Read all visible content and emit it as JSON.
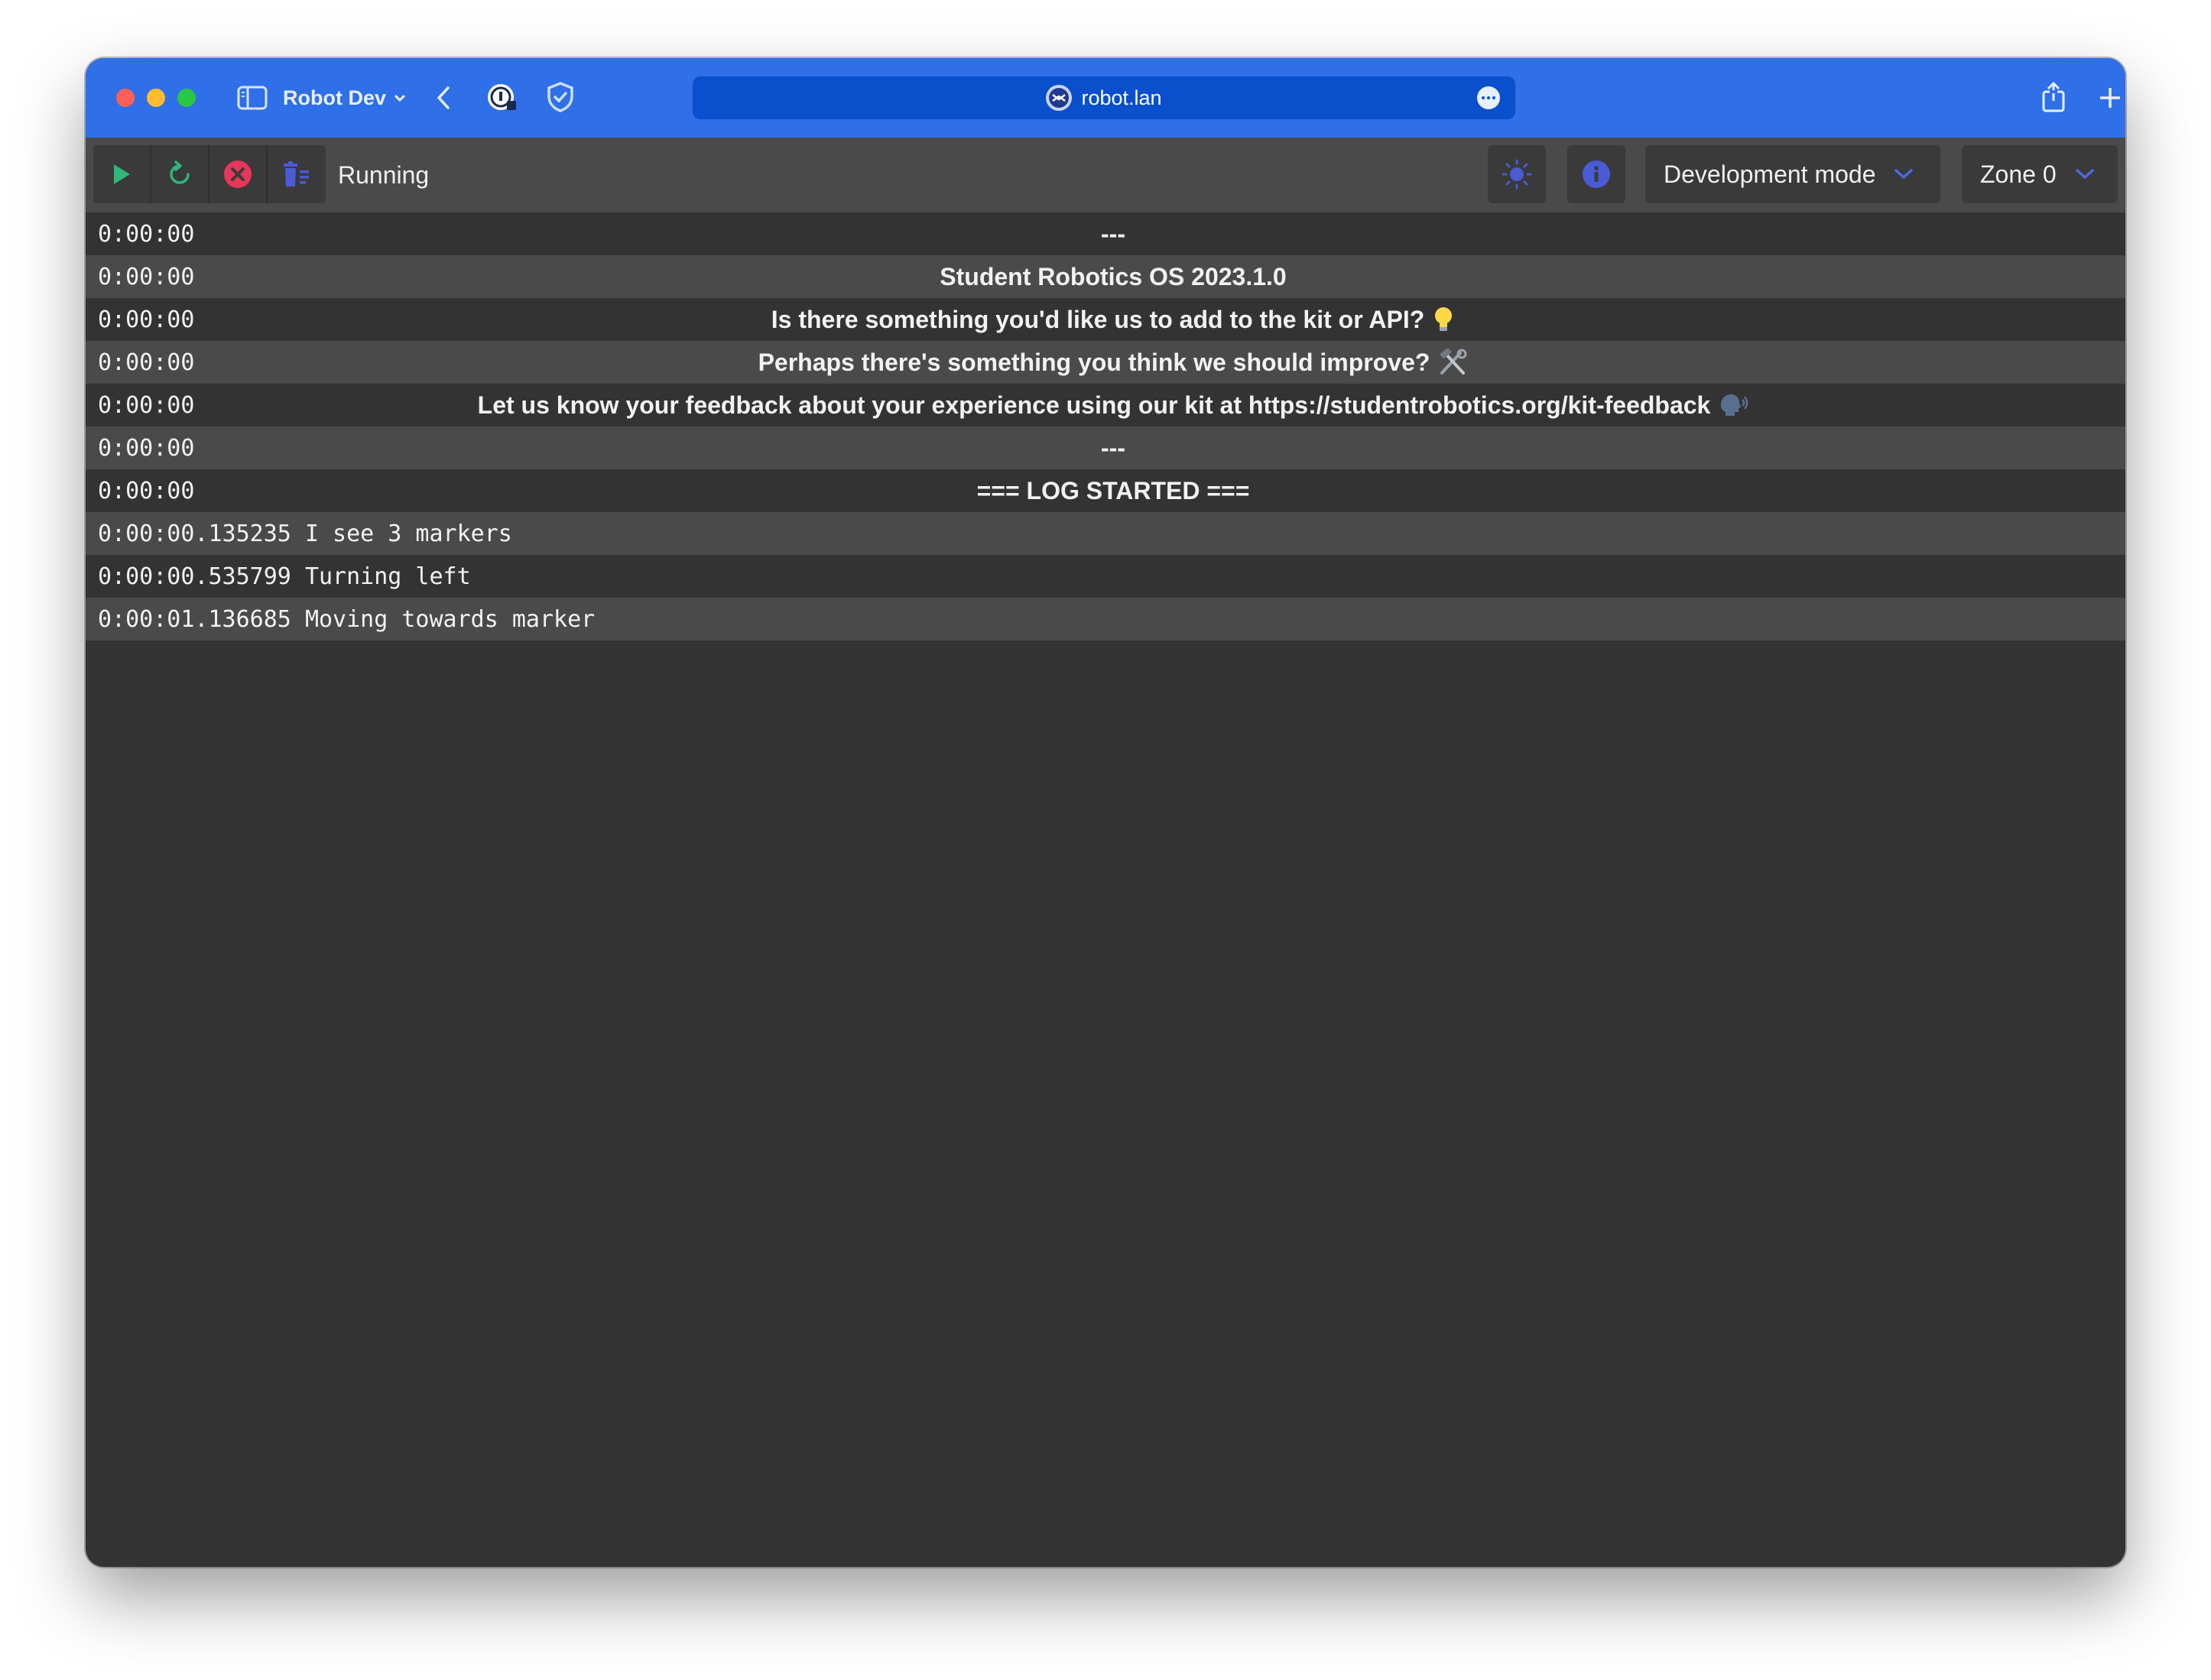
{
  "browser": {
    "tab_group_name": "Robot Dev",
    "address": "robot.lan"
  },
  "toolbar": {
    "status": "Running",
    "mode_selected": "Development mode",
    "zone_selected": "Zone 0"
  },
  "log": {
    "header_rows": [
      {
        "time": "0:00:00",
        "text": "---"
      },
      {
        "time": "0:00:00",
        "text": "Student Robotics OS 2023.1.0"
      },
      {
        "time": "0:00:00",
        "text": "Is there something you'd like us to add to the kit or API?",
        "icon": "lightbulb-icon"
      },
      {
        "time": "0:00:00",
        "text": "Perhaps there's something you think we should improve?",
        "icon": "hammer-wrench-icon"
      },
      {
        "time": "0:00:00",
        "text": "Let us know your feedback about your experience using our kit at https://studentrobotics.org/kit-feedback",
        "icon": "speaking-head-icon"
      },
      {
        "time": "0:00:00",
        "text": "---"
      },
      {
        "time": "0:00:00",
        "text": "=== LOG STARTED ==="
      }
    ],
    "entries": [
      {
        "time": "0:00:00.135235",
        "text": "I see 3 markers"
      },
      {
        "time": "0:00:00.535799",
        "text": "Turning left"
      },
      {
        "time": "0:00:01.136685",
        "text": "Moving towards marker"
      }
    ]
  },
  "colors": {
    "browser_bar": "#2f6fe8",
    "address_bar": "#0a4fcc",
    "toolbar": "#4a4a4a",
    "log_background": "#333333",
    "log_alt_row": "#4a4a4a",
    "play_green": "#2fb67a",
    "stop_red": "#e8365a",
    "accent_blue": "#4a5bd6"
  }
}
